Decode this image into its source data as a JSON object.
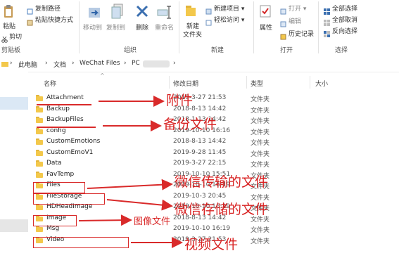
{
  "ribbon": {
    "clipboard": {
      "paste": "粘贴",
      "copy_path": "复制路径",
      "paste_shortcut": "粘贴快捷方式",
      "cut": "剪切",
      "group": "剪贴板"
    },
    "organize": {
      "move_to": "移动到",
      "copy_to": "复制到",
      "delete": "删除",
      "rename": "重命名",
      "group": "组织"
    },
    "new": {
      "new_folder": "新建\n文件夹",
      "new_folder_l1": "新建",
      "new_folder_l2": "文件夹",
      "new_item": "新建项目 ▾",
      "easy_access": "轻松访问 ▾",
      "group": "新建"
    },
    "open": {
      "properties": "属性",
      "open": "打开 ▾",
      "edit": "编辑",
      "history": "历史记录",
      "group": "打开"
    },
    "select": {
      "select_all": "全部选择",
      "select_none": "全部取消",
      "invert": "反向选择",
      "group": "选择"
    }
  },
  "address": {
    "crumbs": [
      "此电脑",
      "文档",
      "WeChat Files",
      "PC"
    ],
    "separator": "›"
  },
  "columns": {
    "name": "名称",
    "date": "修改日期",
    "type": "类型",
    "size": "大小"
  },
  "rows": [
    {
      "name": "Attachment",
      "date": "2019-3-27 21:53",
      "type": "文件夹"
    },
    {
      "name": "Backup",
      "date": "2018-8-13 14:42",
      "type": "文件夹"
    },
    {
      "name": "BackupFiles",
      "date": "2018-1-13 14:42",
      "type": "文件夹"
    },
    {
      "name": "config",
      "date": "2019-10-10 16:16",
      "type": "文件夹"
    },
    {
      "name": "CustomEmotions",
      "date": "2018-8-13 14:42",
      "type": "文件夹"
    },
    {
      "name": "CustomEmoV1",
      "date": "2019-9-28 11:45",
      "type": "文件夹"
    },
    {
      "name": "Data",
      "date": "2019-3-27 22:15",
      "type": "文件夹"
    },
    {
      "name": "FavTemp",
      "date": "2019-10-10 15:51",
      "type": "文件夹"
    },
    {
      "name": "Files",
      "date": "2019-10-10 16:19",
      "type": "文件夹"
    },
    {
      "name": "FileStorage",
      "date": "2019-10-3 20:45",
      "type": "文件夹"
    },
    {
      "name": "HDHeadImage",
      "date": "2019-10-10 16:19",
      "type": "文件夹"
    },
    {
      "name": "Image",
      "date": "2018-8-13 14:42",
      "type": "文件夹"
    },
    {
      "name": "Msg",
      "date": "2019-10-10 16:19",
      "type": "文件夹"
    },
    {
      "name": "Video",
      "date": "2019-3-27 21:53",
      "type": "文件夹"
    }
  ],
  "annotations": {
    "attachment": "附件",
    "backup": "备份文件",
    "files": "微信传输的文件",
    "filestorage": "微信存储的文件",
    "image": "图像文件",
    "video": "视频文件"
  },
  "colors": {
    "annotation": "#d92a2a",
    "folder": "#f3c84b",
    "selection": "#dbe8f5"
  }
}
